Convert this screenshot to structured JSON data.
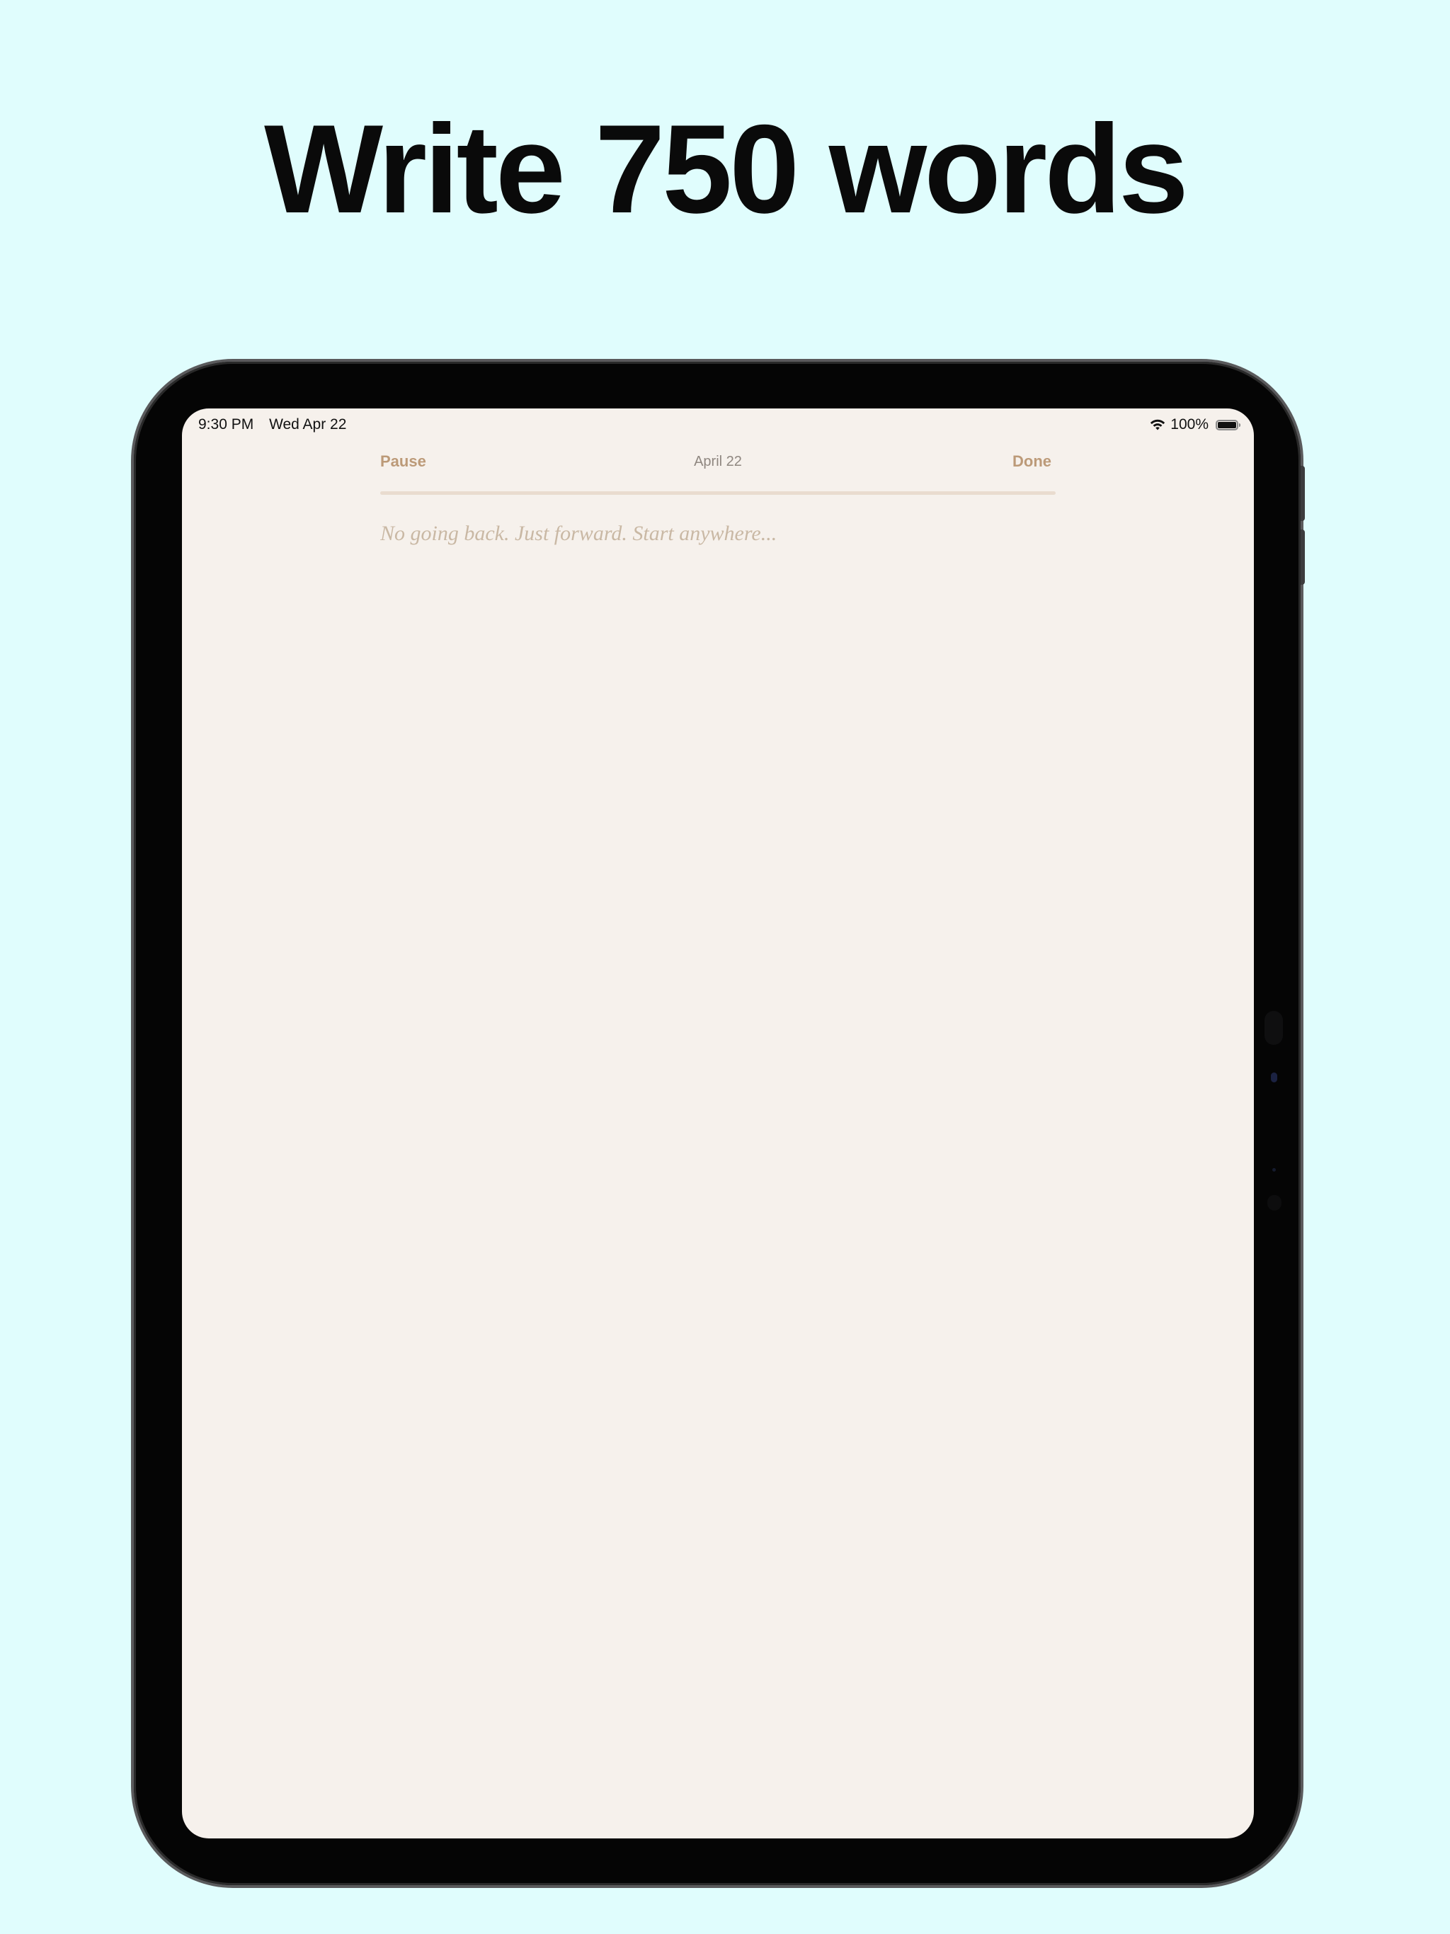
{
  "headline": "Write 750 words",
  "status_bar": {
    "time": "9:30 PM",
    "date": "Wed Apr 22",
    "battery_percent": "100%",
    "battery_level": 1.0
  },
  "toolbar": {
    "pause_label": "Pause",
    "date_label": "April 22",
    "done_label": "Done"
  },
  "progress": {
    "value": 0
  },
  "editor": {
    "placeholder": "No going back. Just forward. Start anywhere..."
  },
  "colors": {
    "page_background": "#e0fdfd",
    "screen_background": "#f6f1ec",
    "accent": "#bc9a78",
    "progress_track": "#e9dccf",
    "placeholder": "#c9b8a4"
  },
  "icons": [
    "wifi-icon",
    "battery-icon"
  ]
}
